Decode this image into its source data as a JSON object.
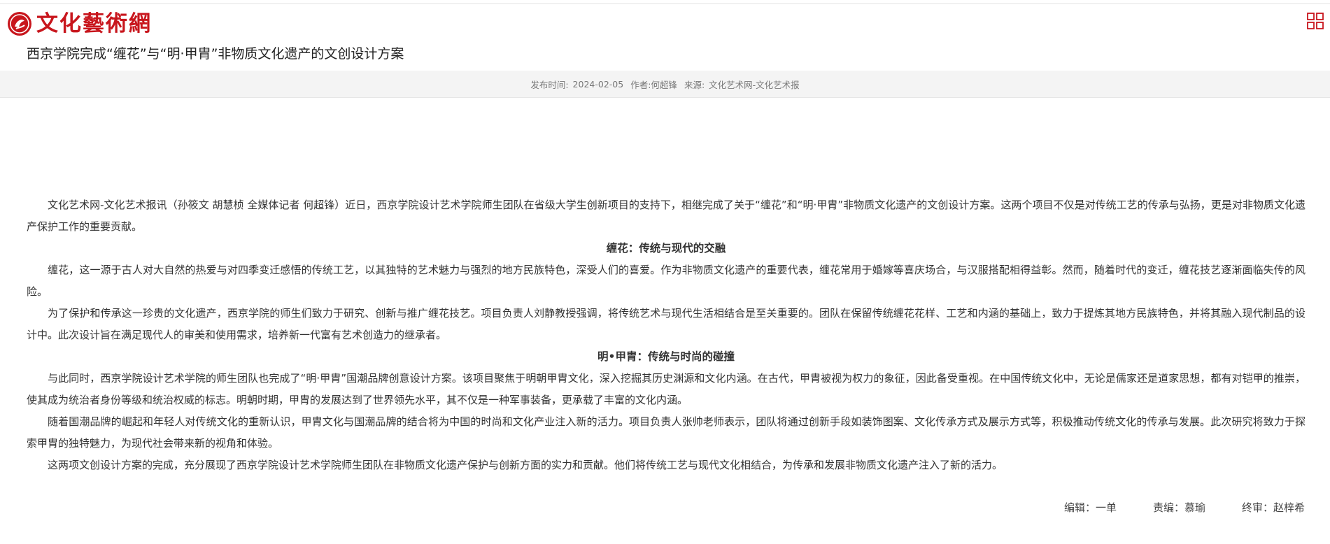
{
  "header": {
    "logo_text": "文化藝術網",
    "logo_icon": "red-circle-emblem-icon",
    "menu_icon": "grid-menu-icon",
    "brand_color": "#c8161d"
  },
  "article": {
    "title": "西京学院完成“缠花”与“明·甲胄”非物质文化遗产的文创设计方案",
    "meta": {
      "published_label": "发布时间:",
      "published_date": "2024-02-05",
      "author_label": "作者:",
      "author": "何超锋",
      "source_label": "来源:",
      "source": "文化艺术网-文化艺术报"
    },
    "blocks": [
      {
        "type": "p",
        "text": "文化艺术网-文化艺术报讯（孙筱文  胡慧桢  全媒体记者 何超锋）近日，西京学院设计艺术学院师生团队在省级大学生创新项目的支持下，相继完成了关于“缠花”和“明·甲胄”非物质文化遗产的文创设计方案。这两个项目不仅是对传统工艺的传承与弘扬，更是对非物质文化遗产保护工作的重要贡献。"
      },
      {
        "type": "h",
        "text": "缠花：传统与现代的交融"
      },
      {
        "type": "p",
        "text": "缠花，这一源于古人对大自然的热爱与对四季变迁感悟的传统工艺，以其独特的艺术魅力与强烈的地方民族特色，深受人们的喜爱。作为非物质文化遗产的重要代表，缠花常用于婚嫁等喜庆场合，与汉服搭配相得益彰。然而，随着时代的变迁，缠花技艺逐渐面临失传的风险。"
      },
      {
        "type": "p",
        "text": "为了保护和传承这一珍贵的文化遗产，西京学院的师生们致力于研究、创新与推广缠花技艺。项目负责人刘静教授强调，将传统艺术与现代生活相结合是至关重要的。团队在保留传统缠花花样、工艺和内涵的基础上，致力于提炼其地方民族特色，并将其融入现代制品的设计中。此次设计旨在满足现代人的审美和使用需求，培养新一代富有艺术创造力的继承者。"
      },
      {
        "type": "h",
        "text": "明•甲胄：传统与时尚的碰撞"
      },
      {
        "type": "p",
        "text": "与此同时，西京学院设计艺术学院的师生团队也完成了“明·甲胄”国潮品牌创意设计方案。该项目聚焦于明朝甲胄文化，深入挖掘其历史渊源和文化内涵。在古代，甲胄被视为权力的象征，因此备受重视。在中国传统文化中，无论是儒家还是道家思想，都有对铠甲的推崇，使其成为统治者身份等级和统治权威的标志。明朝时期，甲胄的发展达到了世界领先水平，其不仅是一种军事装备，更承载了丰富的文化内涵。"
      },
      {
        "type": "p",
        "text": "随着国潮品牌的崛起和年轻人对传统文化的重新认识，甲胄文化与国潮品牌的结合将为中国的时尚和文化产业注入新的活力。项目负责人张帅老师表示，团队将通过创新手段如装饰图案、文化传承方式及展示方式等，积极推动传统文化的传承与发展。此次研究将致力于探索甲胄的独特魅力，为现代社会带来新的视角和体验。"
      },
      {
        "type": "p",
        "text": "这两项文创设计方案的完成，充分展现了西京学院设计艺术学院师生团队在非物质文化遗产保护与创新方面的实力和贡献。他们将传统工艺与现代文化相结合，为传承和发展非物质文化遗产注入了新的活力。"
      }
    ],
    "credits": {
      "editor": "编辑：一单",
      "responsible_editor": "责编：慕瑜",
      "final_review": "终审：赵梓希"
    }
  }
}
